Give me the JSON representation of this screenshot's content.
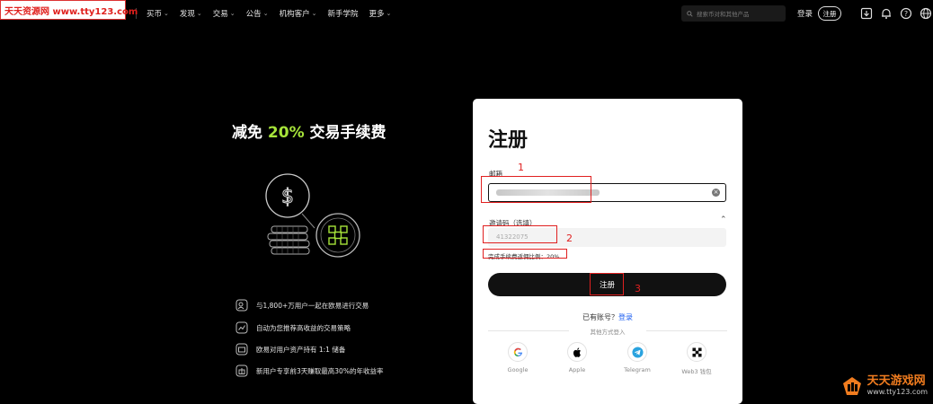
{
  "watermark": {
    "top_text": "天天资源网 www.tty123.com",
    "bottom_main": "天天游戏网",
    "bottom_sub": "www.tty123.com"
  },
  "nav": {
    "items": [
      {
        "label": "买币",
        "dropdown": true
      },
      {
        "label": "发现",
        "dropdown": true
      },
      {
        "label": "交易",
        "dropdown": true
      },
      {
        "label": "公告",
        "dropdown": true
      },
      {
        "label": "机构客户",
        "dropdown": true
      },
      {
        "label": "新手学院",
        "dropdown": false
      },
      {
        "label": "更多",
        "dropdown": true
      }
    ],
    "search_placeholder": "搜索币对和其他产品",
    "login": "登录",
    "signup": "注册",
    "icons": [
      "download-icon",
      "bell-icon",
      "help-icon",
      "globe-icon"
    ]
  },
  "promo": {
    "title_prefix": "减免 ",
    "title_highlight": "20%",
    "title_suffix": " 交易手续费",
    "features": [
      {
        "icon": "users-icon",
        "text": "与1,800+万用户一起在欧易进行交易"
      },
      {
        "icon": "strategy-icon",
        "text": "自动为您推荐高收益的交易策略"
      },
      {
        "icon": "wallet-icon",
        "text": "欧易对用户资产持有 1:1 储备"
      },
      {
        "icon": "gift-icon",
        "text": "新用户专享前3天赚取最高30%的年收益率"
      }
    ]
  },
  "form": {
    "title": "注册",
    "email_label": "邮箱",
    "invite_label": "邀请码（选填）",
    "invite_value": "41322075",
    "rebate_text": "完成手续费返佣比例：20%",
    "register_button": "注册",
    "have_account": "已有账号？",
    "login_link": "登录",
    "other_ways": "其他方式登入",
    "socials": [
      {
        "name": "Google",
        "icon": "google-icon"
      },
      {
        "name": "Apple",
        "icon": "apple-icon"
      },
      {
        "name": "Telegram",
        "icon": "telegram-icon"
      },
      {
        "name": "Web3 钱包",
        "icon": "web3-wallet-icon"
      }
    ]
  },
  "annotations": [
    "1",
    "2",
    "3"
  ],
  "colors": {
    "accent_green": "#a6e33a",
    "link_blue": "#1a5cf0",
    "annotation_red": "#e02020"
  }
}
